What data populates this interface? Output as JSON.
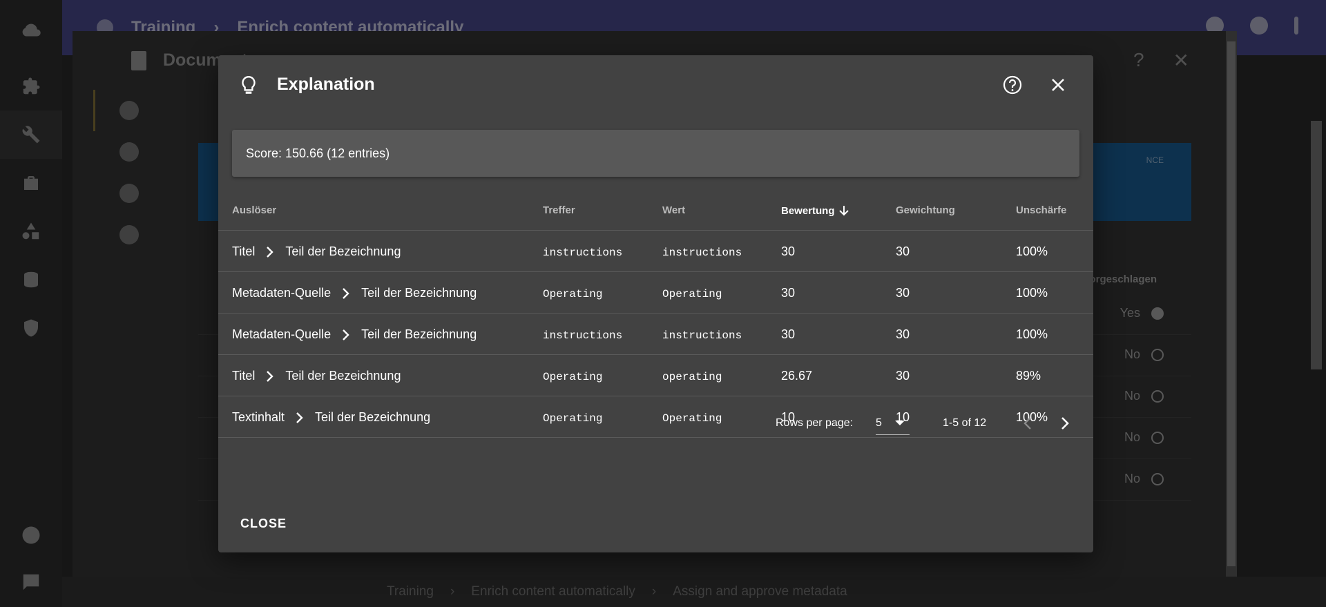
{
  "background": {
    "topbar_crumbs": [
      "Training",
      "Enrich content automatically"
    ],
    "dialog_title": "Document",
    "bottom_crumbs": [
      "Training",
      "Enrich content automatically",
      "Assign and approve metadata"
    ],
    "column_header": "Vorgeschlagen",
    "banner_label": "NCE",
    "rows": [
      "Yes",
      "No",
      "No",
      "No",
      "No"
    ]
  },
  "dialog": {
    "title": "Explanation",
    "score": "Score: 150.66 (12 entries)",
    "columns": [
      "Auslöser",
      "Treffer",
      "Wert",
      "Bewertung",
      "Gewichtung",
      "Unschärfe"
    ],
    "rows": [
      {
        "source": "Titel",
        "field": "Teil der Bezeichnung",
        "hit": "instructions",
        "value": "instructions",
        "rating": "30",
        "weight": "30",
        "fuzz": "100%"
      },
      {
        "source": "Metadaten-Quelle",
        "field": "Teil der Bezeichnung",
        "hit": "Operating",
        "value": "Operating",
        "rating": "30",
        "weight": "30",
        "fuzz": "100%"
      },
      {
        "source": "Metadaten-Quelle",
        "field": "Teil der Bezeichnung",
        "hit": "instructions",
        "value": "instructions",
        "rating": "30",
        "weight": "30",
        "fuzz": "100%"
      },
      {
        "source": "Titel",
        "field": "Teil der Bezeichnung",
        "hit": "Operating",
        "value": "operating",
        "rating": "26.67",
        "weight": "30",
        "fuzz": "89%"
      },
      {
        "source": "Textinhalt",
        "field": "Teil der Bezeichnung",
        "hit": "Operating",
        "value": "Operating",
        "rating": "10",
        "weight": "10",
        "fuzz": "100%"
      }
    ],
    "pagination": {
      "rows_per_page_label": "Rows per page:",
      "rows_per_page": "5",
      "range": "1-5 of 12"
    },
    "close_label": "CLOSE"
  }
}
